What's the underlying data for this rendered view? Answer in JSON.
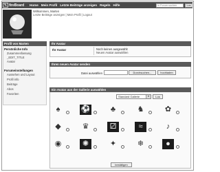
{
  "nav": {
    "brand": "fireBoard",
    "links": [
      "Home",
      "Mein Profil",
      "Letzte Beiträge anzeigen",
      "Regeln",
      "Hilfe"
    ],
    "search_placeholder": "in Forum suchen",
    "search_button": "Los"
  },
  "header": {
    "welcome": "Willkommen, Marten",
    "links": "Letzte Beiträge anzeigen | Mein Profil | Logout"
  },
  "sidebar": {
    "title": "Profil von Marten",
    "section1": {
      "title": "Persönliche Info",
      "items": [
        "Zusammenfassung",
        "_EDIT_TITLE",
        "Avatar"
      ]
    },
    "section2": {
      "title": "Forumeinstellungen",
      "items": [
        "Aussehen und Layout",
        "Profil info",
        "Beiträge",
        "Abos",
        "Favoriten"
      ]
    }
  },
  "avatar_panel": {
    "title": "Ihr Avatar",
    "label": "Ihr Avatar",
    "status1": "Noch keinen ausgewählt",
    "status2": "Neuen Avatar auswählen"
  },
  "upload_panel": {
    "title": "Ihren neuen Avatar senden",
    "file_label": "Datei auswählen",
    "browse_button": "Durchsuchen...",
    "upload_button": "hochladen"
  },
  "gallery_panel": {
    "title": "Ein Avatar aus der Gallerie auswählen",
    "select_value": "Standard Gallerie",
    "go_button": "Los",
    "items": [
      {
        "name": "mushroom",
        "glyph": "♠"
      },
      {
        "name": "soccer-ball",
        "glyph": "⚽"
      },
      {
        "name": "tree",
        "glyph": "♣"
      },
      {
        "name": "dog",
        "glyph": "♞"
      },
      {
        "name": "ladybug",
        "glyph": "✿"
      },
      {
        "name": "kite",
        "glyph": "◆"
      },
      {
        "name": "duck",
        "glyph": "♛"
      },
      {
        "name": "dice",
        "glyph": "⚂"
      },
      {
        "name": "ocean",
        "glyph": "≈"
      },
      {
        "name": "guitar",
        "glyph": "♪"
      },
      {
        "name": "dj",
        "glyph": "◉"
      },
      {
        "name": "shell",
        "glyph": "✺"
      },
      {
        "name": "bulb",
        "glyph": "✦"
      },
      {
        "name": "crystal",
        "glyph": "❄"
      },
      {
        "name": "pool-balls",
        "glyph": "●"
      }
    ],
    "confirm_button": "bestätigen"
  }
}
